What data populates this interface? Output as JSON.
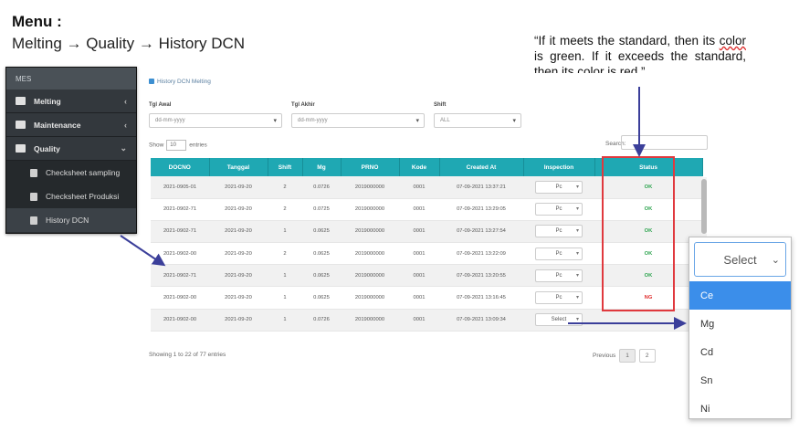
{
  "menu": {
    "title": "Menu :",
    "path": "Melting → Quality → History DCN"
  },
  "note": {
    "line1": "“If it meets the standard, then its",
    "word_color": "color",
    "line2": " is green. If it exceeds the standard, then its ",
    "line3": " is red.”"
  },
  "sidebar": {
    "header": "MES",
    "items": [
      {
        "label": "Melting",
        "icon": "folder-icon"
      },
      {
        "label": "Maintenance",
        "icon": "wrench-icon"
      },
      {
        "label": "Quality",
        "icon": "check-icon"
      }
    ],
    "subitems": [
      {
        "label": "Checksheet sampling",
        "icon": "document-icon"
      },
      {
        "label": "Checksheet Produksi",
        "icon": "document-icon"
      },
      {
        "label": "History DCN",
        "icon": "history-icon"
      }
    ]
  },
  "panel": {
    "breadcrumb": "History DCN Melting",
    "filters": [
      {
        "label": "Tgl Awal",
        "value": "dd-mm-yyyy"
      },
      {
        "label": "Tgl Akhir",
        "value": "dd-mm-yyyy"
      },
      {
        "label": "Shift",
        "value": "ALL"
      }
    ],
    "show_label": "Show",
    "show_value": "10",
    "entries_label": "entries",
    "search_label": "Search:",
    "columns": [
      "DOCNO",
      "Tanggal",
      "Shift",
      "Mg",
      "PRNO",
      "Kode",
      "Created At",
      "Inspection",
      "Status"
    ],
    "rows": [
      [
        "2021-0905-01",
        "2021-09-20",
        "2",
        "0.0726",
        "2019000000",
        "0001",
        "07-09-2021 13:37:21",
        "Pc",
        "OK"
      ],
      [
        "2021-0902-71",
        "2021-09-20",
        "2",
        "0.0725",
        "2019000000",
        "0001",
        "07-09-2021 13:29:05",
        "Pc",
        "OK"
      ],
      [
        "2021-0902-71",
        "2021-09-20",
        "1",
        "0.0625",
        "2019000000",
        "0001",
        "07-09-2021 13:27:54",
        "Pc",
        "OK"
      ],
      [
        "2021-0902-00",
        "2021-09-20",
        "2",
        "0.0625",
        "2019000000",
        "0001",
        "07-09-2021 13:22:09",
        "Pc",
        "OK"
      ],
      [
        "2021-0902-71",
        "2021-09-20",
        "1",
        "0.0625",
        "2019000000",
        "0001",
        "07-09-2021 13:20:55",
        "Pc",
        "OK"
      ],
      [
        "2021-0902-00",
        "2021-09-20",
        "1",
        "0.0625",
        "2019000000",
        "0001",
        "07-09-2021 13:16:45",
        "Pc",
        "NG"
      ],
      [
        "2021-0902-00",
        "2021-09-20",
        "1",
        "0.0726",
        "2019000000",
        "0001",
        "07-09-2021 13:09:34",
        "Select",
        ""
      ]
    ],
    "status_colors": {
      "ok": "#2ea44f",
      "ng": "#e03131"
    },
    "footer": "Showing 1 to 22 of 77 entries",
    "pager": {
      "prev": "Previous",
      "page": "1",
      "next": "2"
    }
  },
  "dropdown": {
    "placeholder": "Select",
    "options": [
      "Ce",
      "Mg",
      "Cd",
      "Sn",
      "Ni"
    ],
    "selected_index": 0
  },
  "accent_colors": {
    "teal_header": "#1fa8b3",
    "highlight_red": "#e0393e",
    "arrow_navy": "#3b3f9a",
    "select_blue": "#3b8eea"
  }
}
